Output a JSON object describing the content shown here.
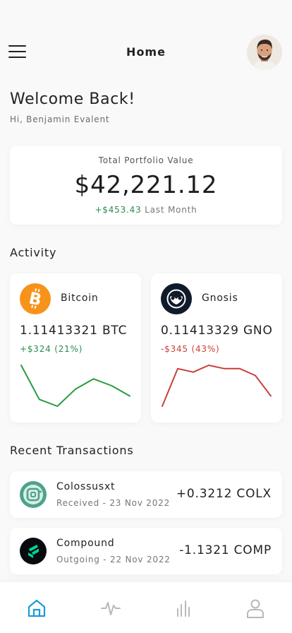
{
  "header": {
    "title": "Home"
  },
  "welcome": {
    "title": "Welcome Back!",
    "subtitle": "Hi, Benjamin Evalent"
  },
  "portfolio": {
    "label": "Total Portfolio Value",
    "value": "$42,221.12",
    "change": "+$453.43",
    "period": "Last Month"
  },
  "activity": {
    "title": "Activity",
    "cards": [
      {
        "name": "Bitcoin",
        "amount": "1.11413321 BTC",
        "change": "+$324 (21%)",
        "icon": "bitcoin-icon",
        "color": "#f7931a",
        "trend": "up",
        "spark": [
          14,
          4,
          2,
          7,
          10,
          8,
          5
        ]
      },
      {
        "name": "Gnosis",
        "amount": "0.11413329 GNO",
        "change": "-$345 (43%)",
        "icon": "gnosis-icon",
        "color": "#0f1a2b",
        "trend": "down",
        "spark": [
          1,
          12,
          11,
          13,
          12,
          12,
          10,
          4
        ]
      }
    ]
  },
  "transactions": {
    "title": "Recent Transactions",
    "items": [
      {
        "name": "Colossusxt",
        "meta": "Received - 23 Nov 2022",
        "amount": "+0.3212 COLX",
        "icon": "colossusxt-icon",
        "color": "#4fa28c"
      },
      {
        "name": "Compound",
        "meta": "Outgoing - 22 Nov 2022",
        "amount": "-1.1321 COMP",
        "icon": "compound-icon",
        "color": "#070a0e"
      }
    ]
  },
  "nav": {
    "items": [
      {
        "icon": "home-icon",
        "active": true
      },
      {
        "icon": "activity-icon",
        "active": false
      },
      {
        "icon": "chart-icon",
        "active": false
      },
      {
        "icon": "profile-icon",
        "active": false
      }
    ],
    "active_color": "#1a9bd7",
    "inactive_color": "#b8b8b8"
  },
  "colors": {
    "positive": "#2e8b4e",
    "negative": "#c8403a",
    "sparkline_positive": "#2a9a3e",
    "sparkline_negative": "#c8403a"
  }
}
